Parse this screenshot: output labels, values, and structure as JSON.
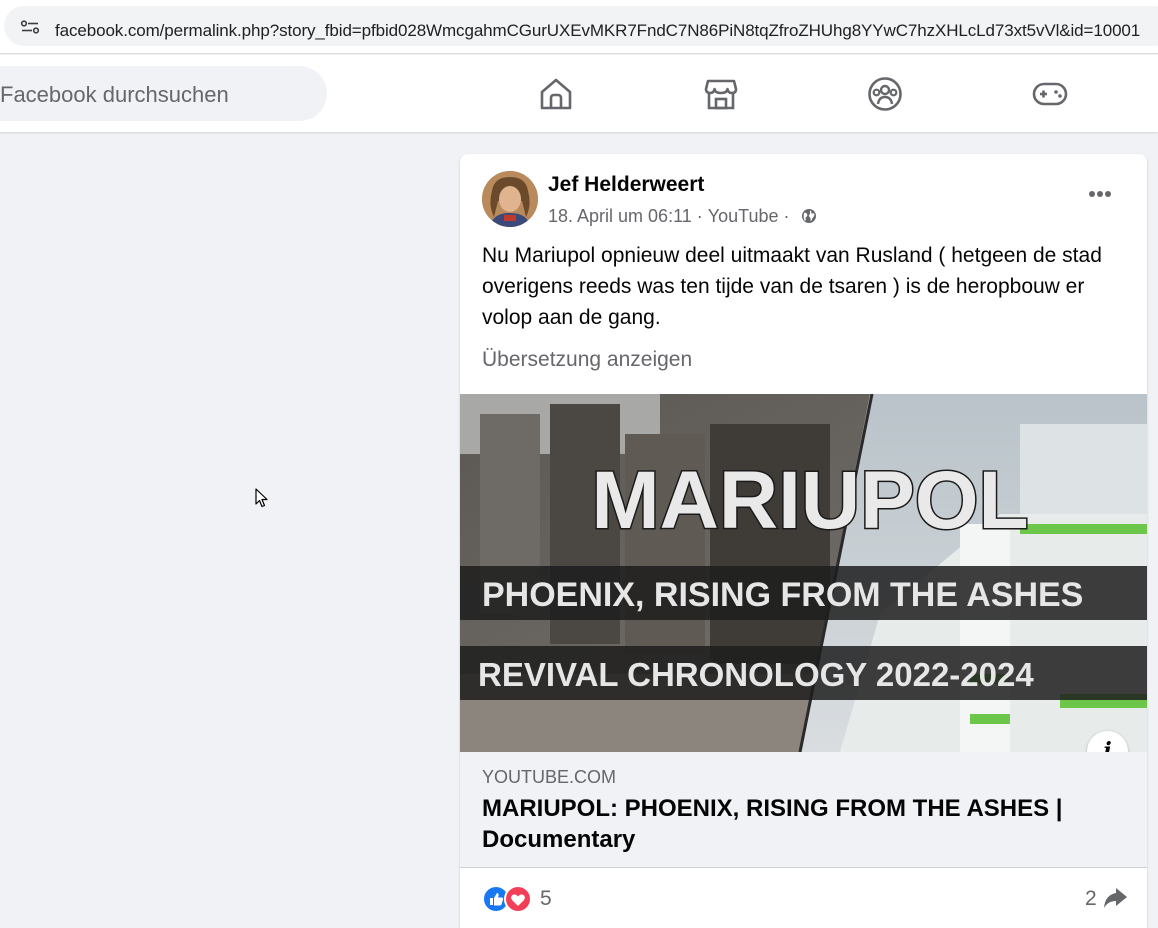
{
  "browser": {
    "url": "facebook.com/permalink.php?story_fbid=pfbid028WmcgahmCGurUXEvMKR7FndC7N86PiN8tqZfroZHUhg8YYwC7hzXHLcLd73xt5vVl&id=10001"
  },
  "header": {
    "search_placeholder": "Facebook durchsuchen",
    "nav": [
      "home-icon",
      "marketplace-icon",
      "groups-icon",
      "gaming-icon"
    ]
  },
  "post": {
    "author": "Jef Helderweert",
    "date": "18. April um 06:11",
    "source": "YouTube",
    "separator": "·",
    "text": "Nu Mariupol opnieuw deel uitmaakt van Rusland ( hetgeen de stad overigens reeds was ten tijde van de tsaren ) is de heropbouw er volop aan de gang.",
    "translate_label": "Übersetzung anzeigen",
    "thumbnail": {
      "title": "MARIUPOL",
      "line1": "PHOENIX, RISING FROM THE ASHES",
      "line2": "REVIVAL CHRONOLOGY 2022-2024"
    },
    "info_label": "i",
    "link": {
      "domain": "YOUTUBE.COM",
      "title": "MARIUPOL: PHOENIX, RISING FROM THE ASHES | Documentary"
    },
    "reaction_count": "5",
    "share_count": "2"
  },
  "colors": {
    "fb_blue": "#1877f2",
    "love_red": "#f33e58",
    "page_bg": "#f0f2f5",
    "icon_gray": "#65676b"
  }
}
